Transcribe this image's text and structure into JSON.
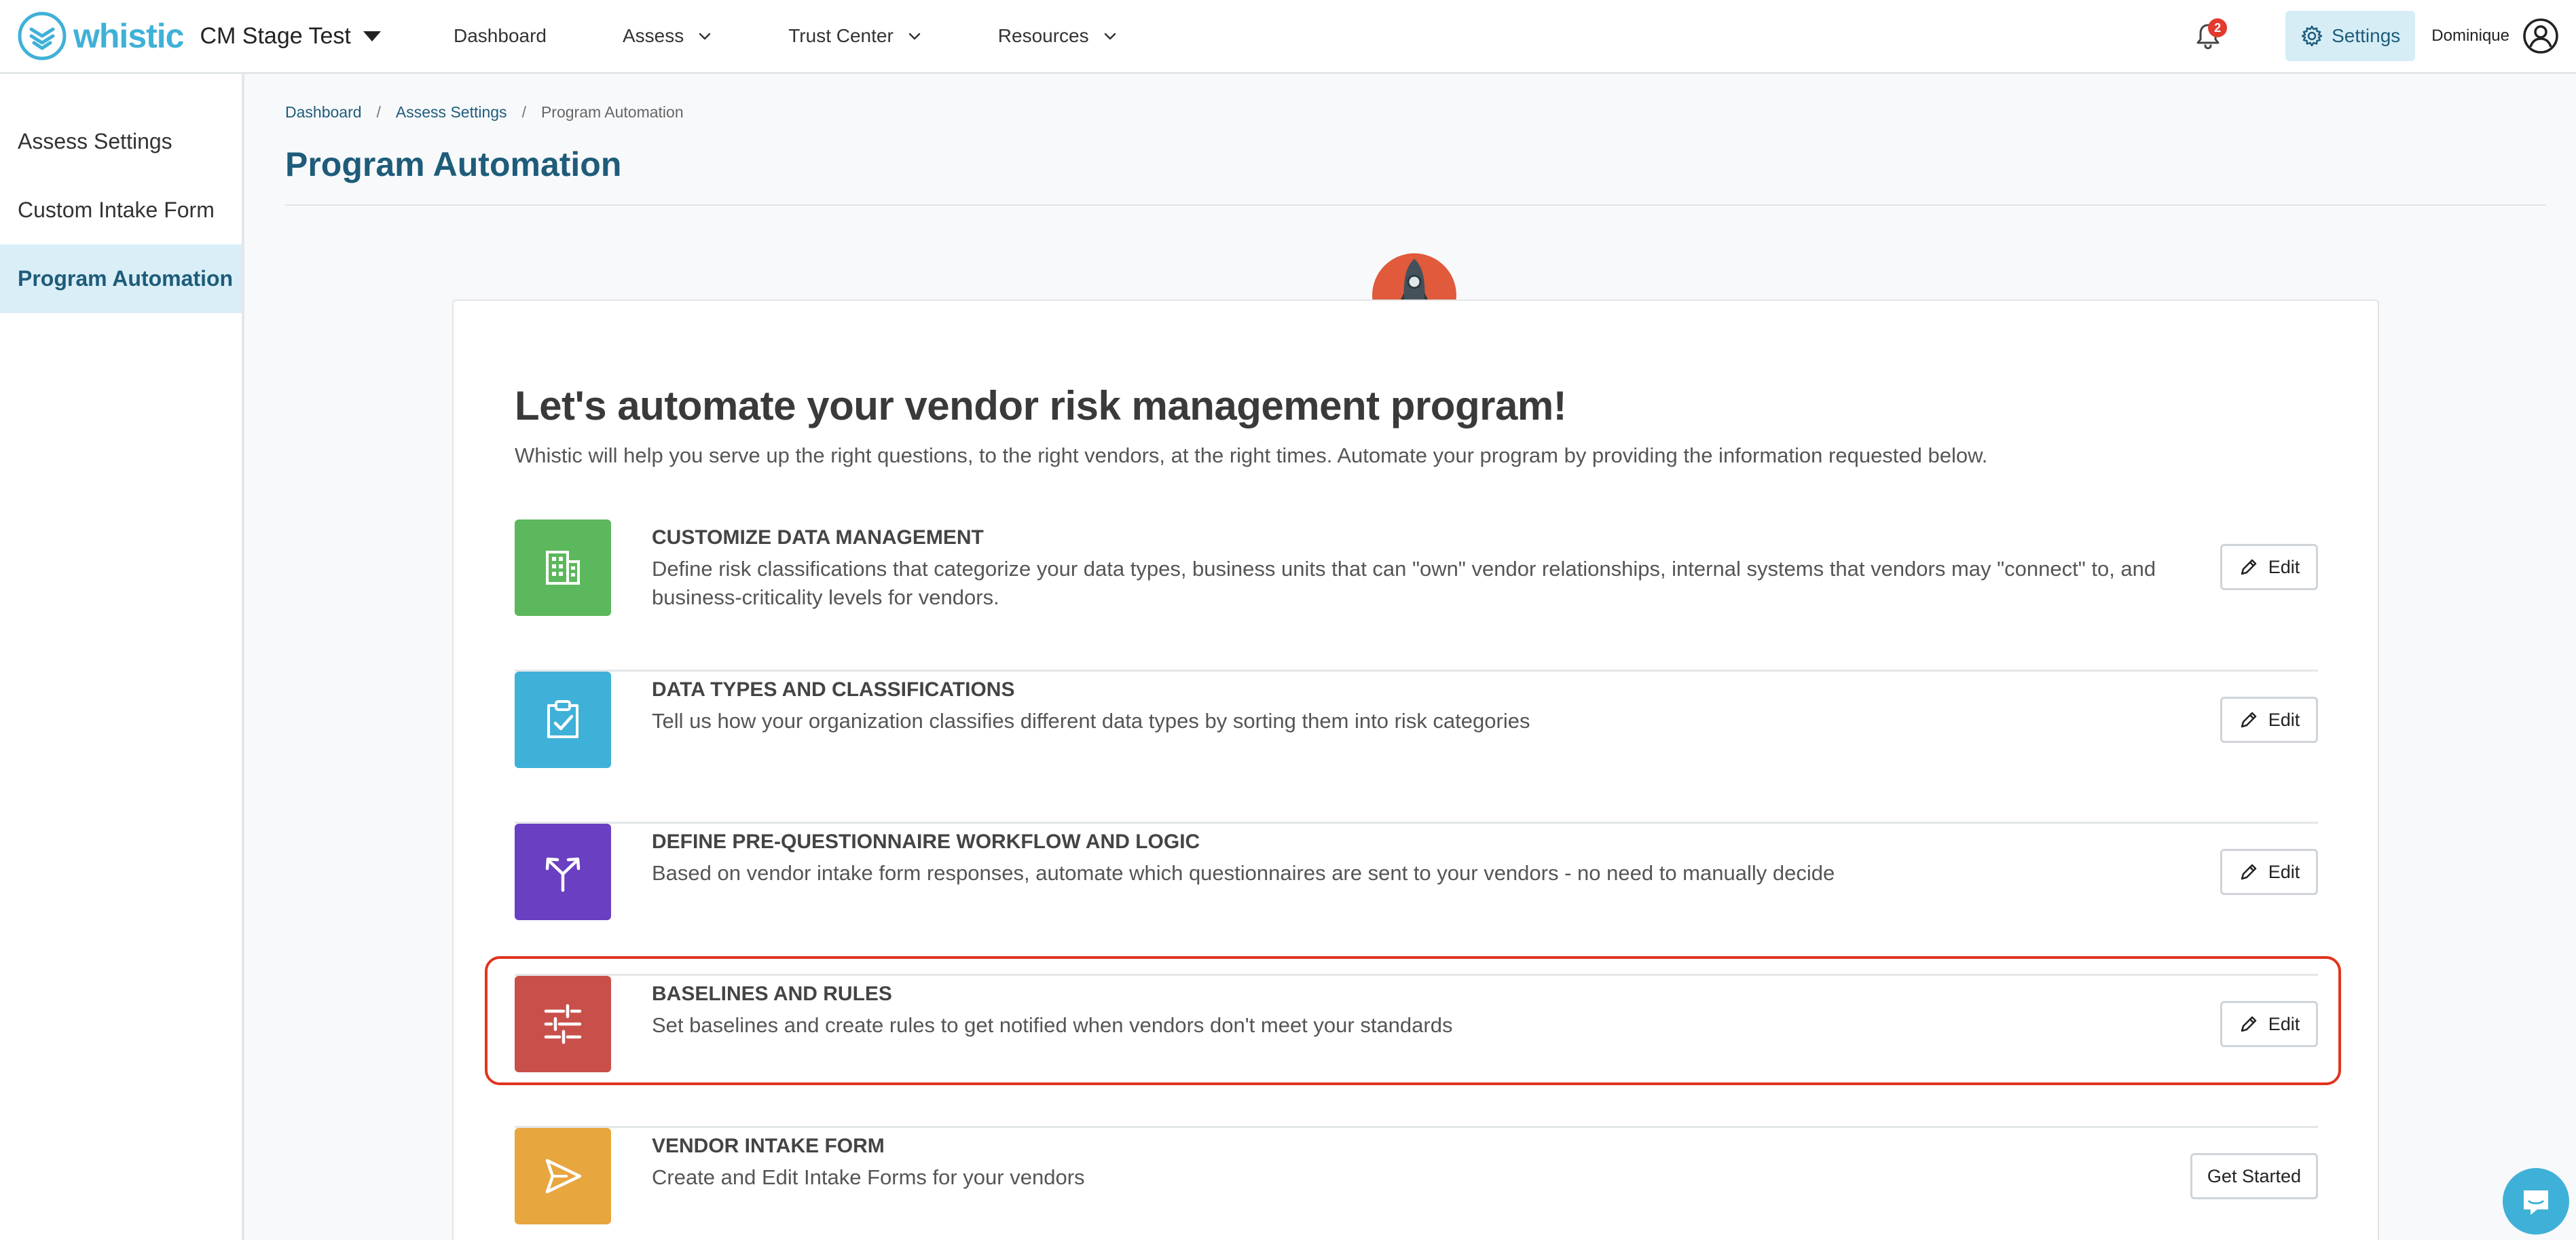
{
  "brand": {
    "logo_text": "whistic",
    "account_name": "CM Stage Test"
  },
  "nav": {
    "links": [
      {
        "label": "Dashboard",
        "has_menu": false
      },
      {
        "label": "Assess",
        "has_menu": true
      },
      {
        "label": "Trust Center",
        "has_menu": true
      },
      {
        "label": "Resources",
        "has_menu": true
      }
    ],
    "notification_count": "2",
    "settings_label": "Settings",
    "user_name": "Dominique"
  },
  "sidebar": {
    "items": [
      {
        "label": "Assess Settings",
        "active": false
      },
      {
        "label": "Custom Intake Form",
        "active": false
      },
      {
        "label": "Program Automation",
        "active": true
      }
    ]
  },
  "breadcrumb": {
    "items": [
      "Dashboard",
      "Assess Settings"
    ],
    "separator": "/",
    "current": "Program Automation"
  },
  "page": {
    "title": "Program Automation"
  },
  "card": {
    "heading": "Let's automate your vendor risk management program!",
    "subtitle": "Whistic will help you serve up the right questions, to the right vendors, at the right times. Automate your program by providing the information requested below.",
    "steps": [
      {
        "title": "CUSTOMIZE DATA MANAGEMENT",
        "description": "Define risk classifications that categorize your data types, business units that can \"own\" vendor relationships, internal systems that vendors may \"connect\" to, and business-criticality levels for vendors.",
        "icon": "building-icon",
        "color": "#5cb85c",
        "button": "Edit"
      },
      {
        "title": "DATA TYPES AND CLASSIFICATIONS",
        "description": "Tell us how your organization classifies different data types by sorting them into risk categories",
        "icon": "clipboard-check-icon",
        "color": "#3fb1d8",
        "button": "Edit"
      },
      {
        "title": "DEFINE PRE-QUESTIONNAIRE WORKFLOW AND LOGIC",
        "description": "Based on vendor intake form responses, automate which questionnaires are sent to your vendors - no need to manually decide",
        "icon": "split-arrows-icon",
        "color": "#6a3fc1",
        "button": "Edit"
      },
      {
        "title": "BASELINES AND RULES",
        "description": "Set baselines and create rules to get notified when vendors don't meet your standards",
        "icon": "sliders-icon",
        "color": "#c9504a",
        "button": "Edit"
      },
      {
        "title": "VENDOR INTAKE FORM",
        "description": "Create and Edit Intake Forms for your vendors",
        "icon": "send-icon",
        "color": "#e8a63f",
        "button": "Get Started"
      }
    ]
  },
  "colors": {
    "brand": "#3fb1d8",
    "primary_dark": "#1e5c7a",
    "highlight": "#e1341e",
    "badge": "#e23a2e"
  }
}
